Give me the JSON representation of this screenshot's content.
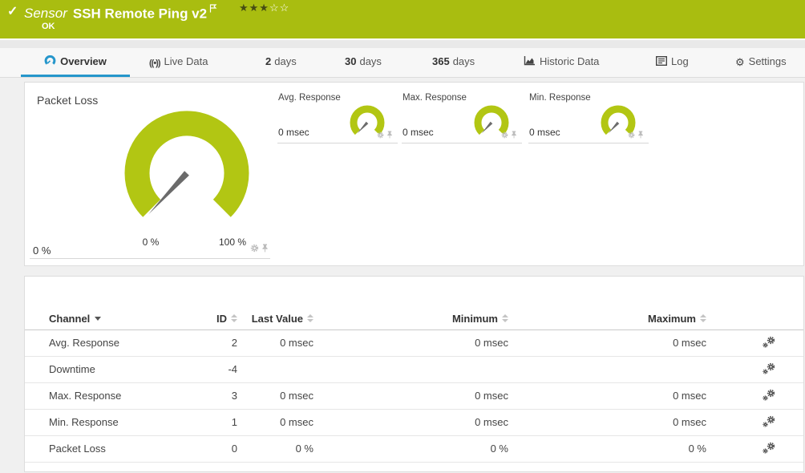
{
  "header": {
    "type_label": "Sensor",
    "title": "SSH Remote Ping v2",
    "status": "OK",
    "rating": {
      "filled": 3,
      "total": 5,
      "stars_filled": "★★★",
      "stars_empty": "☆☆"
    }
  },
  "tabs": [
    {
      "label": "Overview",
      "icon": "gauge-icon",
      "active": true
    },
    {
      "label": "Live Data",
      "icon": "live-data-icon",
      "live_glyph": "((•))"
    },
    {
      "prefix": "2",
      "label": "days"
    },
    {
      "prefix": "30",
      "label": "days"
    },
    {
      "prefix": "365",
      "label": "days"
    },
    {
      "label": "Historic Data",
      "icon": "historic-data-icon"
    },
    {
      "label": "Log",
      "icon": "log-icon"
    },
    {
      "label": "Settings",
      "icon": "gear-icon",
      "gear_glyph": "⚙"
    }
  ],
  "gauges": {
    "primary": {
      "title": "Packet Loss",
      "value": "0 %",
      "scale_min": "0 %",
      "scale_max": "100 %",
      "needle_position_percent": 0
    },
    "secondary": [
      {
        "title": "Avg. Response",
        "value": "0 msec",
        "needle_position": 0
      },
      {
        "title": "Max. Response",
        "value": "0 msec",
        "needle_position": 0
      },
      {
        "title": "Min. Response",
        "value": "0 msec",
        "needle_position": 0
      }
    ]
  },
  "channels": {
    "columns": [
      {
        "label": "Channel",
        "sorted": "desc"
      },
      {
        "label": "ID"
      },
      {
        "label": "Last Value"
      },
      {
        "label": "Minimum"
      },
      {
        "label": "Maximum"
      }
    ],
    "rows": [
      {
        "channel": "Avg. Response",
        "id": "2",
        "last": "0 msec",
        "min": "0 msec",
        "max": "0 msec"
      },
      {
        "channel": "Downtime",
        "id": "-4",
        "last": "",
        "min": "",
        "max": ""
      },
      {
        "channel": "Max. Response",
        "id": "3",
        "last": "0 msec",
        "min": "0 msec",
        "max": "0 msec"
      },
      {
        "channel": "Min. Response",
        "id": "1",
        "last": "0 msec",
        "min": "0 msec",
        "max": "0 msec"
      },
      {
        "channel": "Packet Loss",
        "id": "0",
        "last": "0 %",
        "min": "0 %",
        "max": "0 %"
      }
    ]
  },
  "colors": {
    "brand_green": "#a9bd10",
    "gauge_green": "#b2c613",
    "accent_blue": "#2596cb",
    "needle_gray": "#6b6b6b"
  }
}
